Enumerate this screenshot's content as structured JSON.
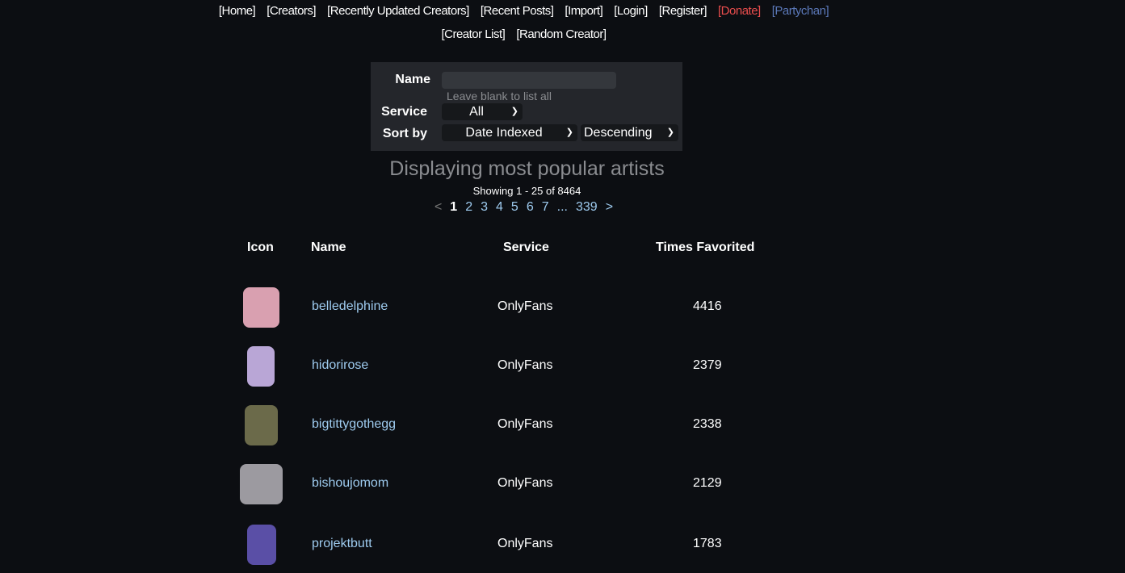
{
  "nav": {
    "row1": [
      "[Home]",
      "[Creators]",
      "[Recently Updated Creators]",
      "[Recent Posts]",
      "[Import]",
      "[Login]",
      "[Register]",
      "[Donate]",
      "[Partychan]"
    ],
    "row2": [
      "[Creator List]",
      "[Random Creator]"
    ]
  },
  "form": {
    "name_label": "Name",
    "name_value": "",
    "hint": "Leave blank to list all",
    "service_label": "Service",
    "service_value": "All",
    "sort_label": "Sort by",
    "sort_value": "Date Indexed",
    "order_value": "Descending"
  },
  "heading": "Displaying most popular artists",
  "showing": "Showing 1 - 25 of 8464",
  "pager": {
    "prev": "<",
    "pages": [
      "1",
      "2",
      "3",
      "4",
      "5",
      "6",
      "7",
      "...",
      "339"
    ],
    "next": ">",
    "current": "1"
  },
  "table": {
    "headers": [
      "Icon",
      "Name",
      "Service",
      "Times Favorited"
    ],
    "rows": [
      {
        "name": "belledelphine",
        "service": "OnlyFans",
        "favorited": "4416",
        "color": "#d9a0b0"
      },
      {
        "name": "hidorirose",
        "service": "OnlyFans",
        "favorited": "2379",
        "color": "#b9a6d6"
      },
      {
        "name": "bigtittygothegg",
        "service": "OnlyFans",
        "favorited": "2338",
        "color": "#6b6a4a"
      },
      {
        "name": "bishoujomom",
        "service": "OnlyFans",
        "favorited": "2129",
        "color": "#9c9aa0"
      },
      {
        "name": "projektbutt",
        "service": "OnlyFans",
        "favorited": "1783",
        "color": "#5a4fa6"
      }
    ]
  }
}
